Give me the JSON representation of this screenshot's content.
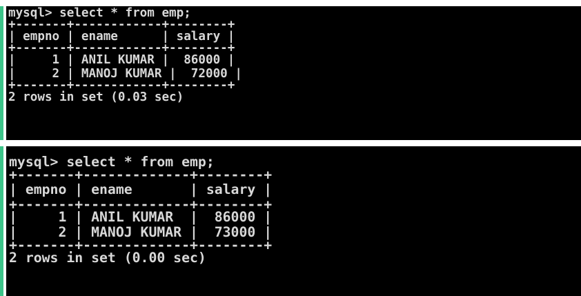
{
  "colors": {
    "console_background": "#000000",
    "console_text": "#d8d8d8",
    "accent_bar": "#3cc489",
    "frame_background": "#ffffff"
  },
  "first_query": {
    "prompt_line": "mysql> select * from emp;",
    "border_top": "+-------+------------+--------+",
    "header_row": "| empno | ename      | salary |",
    "border_mid": "+-------+------------+--------+",
    "row_1": "|     1 | ANIL KUMAR |  86000 |",
    "row_2": "|     2 | MANOJ KUMAR |  72000 |",
    "border_bottom": "+-------+------------+--------+",
    "result_line": "2 rows in set (0.03 sec)"
  },
  "second_query": {
    "prompt_line": "mysql> select * from emp;",
    "border_top": "+-------+-------------+--------+",
    "header_row": "| empno | ename       | salary |",
    "border_mid": "+-------+-------------+--------+",
    "row_1": "|     1 | ANIL KUMAR  |  86000 |",
    "row_2": "|     2 | MANOJ KUMAR |  73000 |",
    "border_bottom": "+-------+-------------+--------+",
    "result_line": "2 rows in set (0.00 sec)"
  }
}
